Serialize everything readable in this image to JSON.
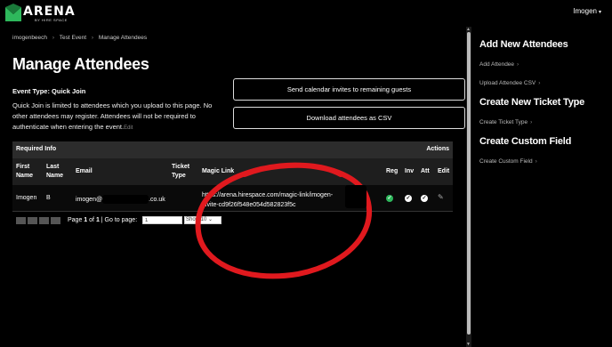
{
  "header": {
    "logo_text": "ARENA",
    "logo_sub": "BY HIRE SPACE",
    "user": "Imogen"
  },
  "breadcrumb": [
    "imogenbeech",
    "Test Event",
    "Manage Attendees"
  ],
  "main": {
    "title": "Manage Attendees",
    "event_type": "Event Type: Quick Join",
    "description": "Quick Join is limited to attendees which you upload to this page. No other attendees may register. Attendees will not be required to authenticate when entering the event.",
    "edit_label": "Edit",
    "send_invites_label": "Send calendar invites to remaining guests",
    "download_label": "Download attendees as CSV"
  },
  "table": {
    "section_label": "Required Info",
    "actions_label": "Actions",
    "columns": {
      "first_name": "First Name",
      "last_name": "Last Name",
      "email": "Email",
      "ticket_type": "Ticket Type",
      "magic_link": "Magic Link",
      "reg": "Reg",
      "inv": "Inv",
      "att": "Att",
      "edit": "Edit"
    },
    "rows": [
      {
        "first_name": "Imogen",
        "last_name": "B",
        "email_prefix": "imogen@",
        "email_suffix": ".co.uk",
        "magic_link_line1": "https://arena.hirespace.com/magic-link/imogen-",
        "magic_link_line2": "invite-cd9f26f548e054d582823f5c"
      }
    ]
  },
  "pager": {
    "page_prefix": "Page ",
    "page_current": "1",
    "page_of": " of ",
    "page_total": "1",
    "goto_label": " | Go to page:",
    "goto_value": "1",
    "show_label": "Show 10"
  },
  "side": {
    "add_attendees_heading": "Add New Attendees",
    "add_attendee_link": "Add Attendee",
    "upload_csv_link": "Upload Attendee CSV",
    "ticket_type_heading": "Create New Ticket Type",
    "create_ticket_link": "Create Ticket Type",
    "custom_field_heading": "Create Custom Field",
    "create_field_link": "Create Custom Field"
  },
  "colors": {
    "background": "#000000",
    "annotation": "#e0191e",
    "reg_check": "#2eb85c"
  }
}
